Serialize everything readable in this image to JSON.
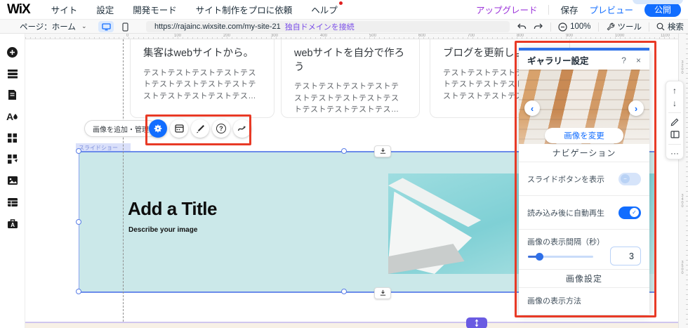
{
  "top_bar": {
    "logo": "WiX",
    "menu": [
      "サイト",
      "設定",
      "開発モード",
      "サイト制作をプロに依頼",
      "ヘルプ"
    ],
    "upgrade": "アップグレード",
    "save": "保存",
    "preview": "プレビュー",
    "publish": "公開"
  },
  "nav_bar": {
    "page_selector": "ページ：ホーム",
    "chevron": "⌄",
    "url": "https://rajainc.wixsite.com/my-site-21",
    "domain_link": "独自ドメインを接続",
    "zoom": "100%",
    "tools": "ツール",
    "search": "検索"
  },
  "left_sidebar": {
    "icons": [
      "add",
      "add-section",
      "pages-menu",
      "site-design",
      "add-apps",
      "quick-actions",
      "media",
      "content-manager",
      "business-tools"
    ]
  },
  "ruler": {
    "h_labels": [
      "0",
      "100",
      "200",
      "300",
      "400",
      "500",
      "600",
      "700",
      "800",
      "900",
      "1000",
      "1100"
    ],
    "v_labels": [
      "3200",
      "3300",
      "3400",
      "3500"
    ]
  },
  "canvas": {
    "cards": [
      {
        "title": "集客はwebサイトから。",
        "body": "テストテストテストテストテストテストテストテストテストテストテストテストテストテストテストテス..."
      },
      {
        "title": "webサイトを自分で作ろう",
        "body": "テストテストテストテストテストテストテストテストテストテストテストテストテストテストテストテス..."
      },
      {
        "title": "ブログを更新しよう",
        "body": "テストテストテストテストテストテストテストテストテストテストテストテストテストテストテストテス..."
      }
    ],
    "gallery": {
      "label": "スライドショー",
      "title": "Add a Title",
      "subtitle": "Describe your image"
    }
  },
  "element_toolbar": {
    "tooltip": "画像を追加・管理",
    "icons": [
      "settings",
      "layout",
      "design",
      "help",
      "animation"
    ],
    "help_glyph": "?"
  },
  "panel": {
    "title": "ギャラリー設定",
    "help_icon": "?",
    "close_icon": "×",
    "prev_arrow": "‹",
    "next_arrow": "›",
    "change_image_button": "画像を変更",
    "section_navigation": "ナビゲーション",
    "section_image_settings": "画像設定",
    "toggles": [
      {
        "label": "スライドボタンを表示",
        "state": "off",
        "knob_glyph": "−"
      },
      {
        "label": "読み込み後に自動再生",
        "state": "on",
        "knob_glyph": "✓"
      }
    ],
    "slider": {
      "label": "画像の表示間隔（秒）",
      "value": "3"
    },
    "display_method_label": "画像の表示方法"
  },
  "right_toolbar": {
    "icons": [
      "arrow-up",
      "arrow-down",
      "pencil",
      "layout-frame",
      "more"
    ],
    "up_glyph": "↑",
    "down_glyph": "↓",
    "more_glyph": "···"
  },
  "colors": {
    "accent_blue": "#116dff",
    "highlight_red": "#e83a26",
    "upgrade_purple": "#9a30d9",
    "domain_link_purple": "#7a4de8",
    "gallery_teal": "#cbe8e9"
  }
}
